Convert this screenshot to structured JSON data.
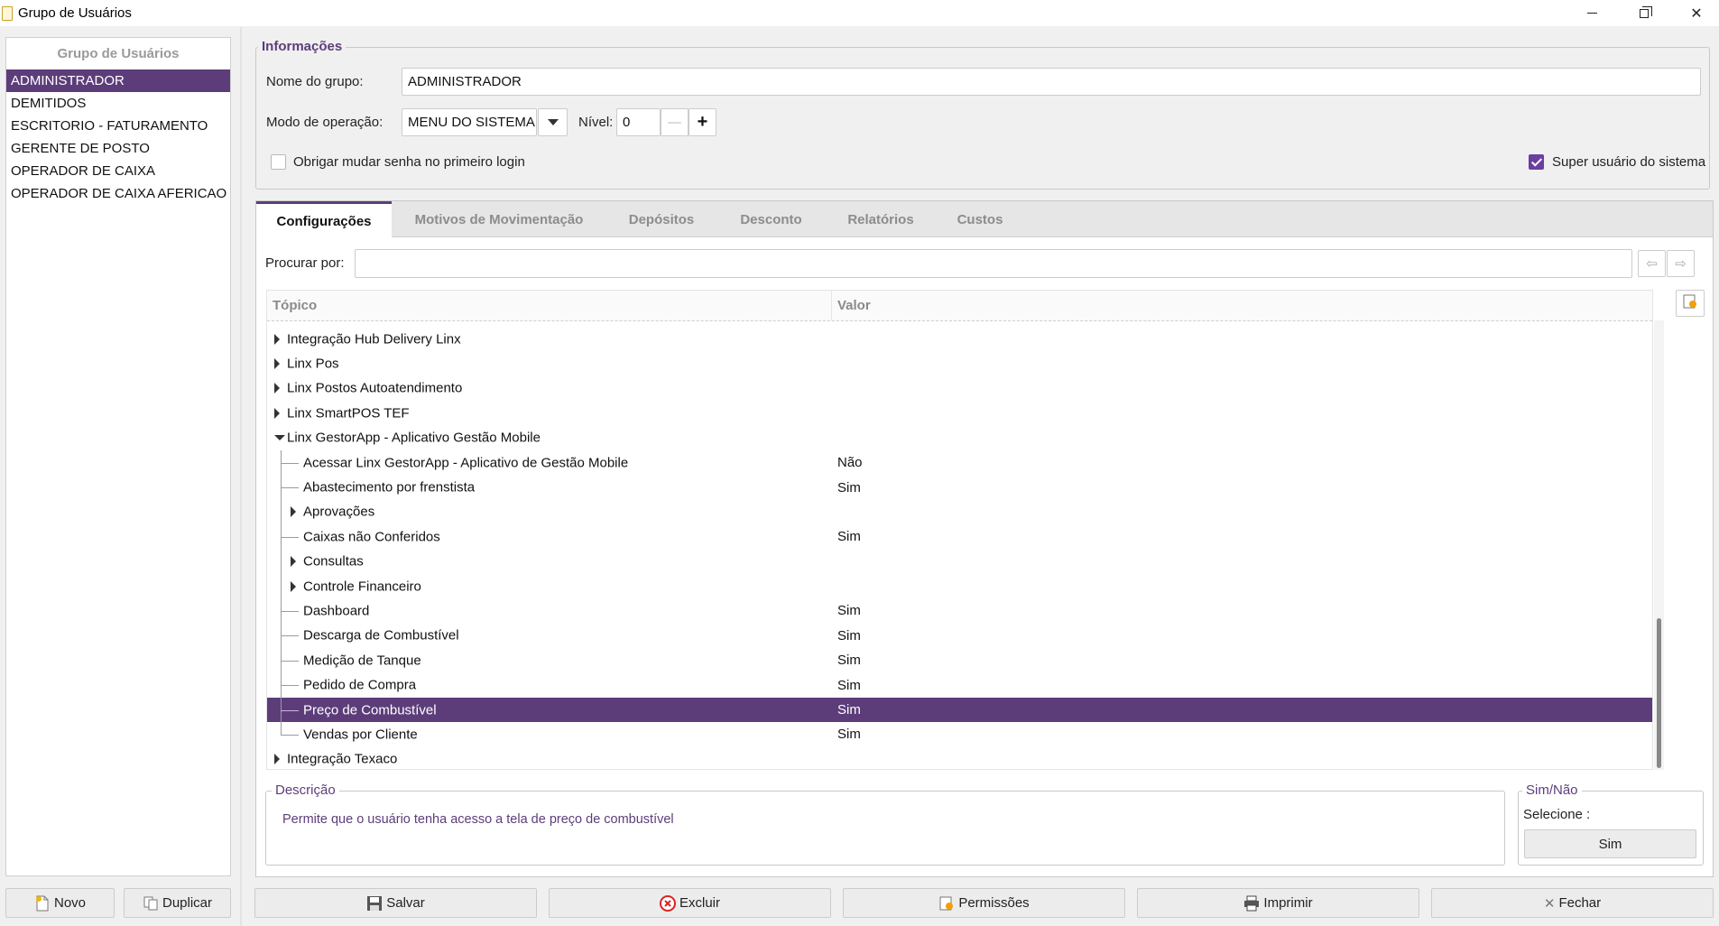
{
  "window": {
    "title": "Grupo de Usuários"
  },
  "left_panel": {
    "header": "Grupo de Usuários",
    "items": [
      {
        "label": "ADMINISTRADOR",
        "selected": true
      },
      {
        "label": "DEMITIDOS"
      },
      {
        "label": "ESCRITORIO - FATURAMENTO"
      },
      {
        "label": "GERENTE DE POSTO"
      },
      {
        "label": "OPERADOR DE CAIXA"
      },
      {
        "label": "OPERADOR DE CAIXA AFERICAO"
      }
    ],
    "buttons": {
      "novo": "Novo",
      "duplicar": "Duplicar"
    }
  },
  "info": {
    "legend": "Informações",
    "group_name_label": "Nome do grupo:",
    "group_name_value": "ADMINISTRADOR",
    "mode_label": "Modo de operação:",
    "mode_value": "MENU DO SISTEMA",
    "level_label": "Nível:",
    "level_value": "0",
    "force_password_label": "Obrigar mudar senha no primeiro login",
    "force_password_checked": false,
    "superuser_label": "Super usuário do sistema",
    "superuser_checked": true
  },
  "tabs": [
    {
      "label": "Configurações",
      "active": true
    },
    {
      "label": "Motivos de Movimentação"
    },
    {
      "label": "Depósitos"
    },
    {
      "label": "Desconto"
    },
    {
      "label": "Relatórios"
    },
    {
      "label": "Custos"
    }
  ],
  "search": {
    "label": "Procurar por:",
    "value": ""
  },
  "tree": {
    "columns": {
      "topic": "Tópico",
      "value": "Valor"
    },
    "rows": [
      {
        "label": "Integração Hub Delivery Linx",
        "level": 0,
        "expander": "collapsed",
        "value": ""
      },
      {
        "label": "Linx Pos",
        "level": 0,
        "expander": "collapsed",
        "value": ""
      },
      {
        "label": "Linx Postos Autoatendimento",
        "level": 0,
        "expander": "collapsed",
        "value": ""
      },
      {
        "label": "Linx SmartPOS TEF",
        "level": 0,
        "expander": "collapsed",
        "value": ""
      },
      {
        "label": "Linx GestorApp - Aplicativo Gestão Mobile",
        "level": 0,
        "expander": "expanded",
        "value": ""
      },
      {
        "label": "Acessar Linx GestorApp - Aplicativo de Gestão Mobile",
        "level": 1,
        "expander": "none",
        "value": "Não"
      },
      {
        "label": "Abastecimento por frenstista",
        "level": 1,
        "expander": "none",
        "value": "Sim"
      },
      {
        "label": "Aprovações",
        "level": 1,
        "expander": "collapsed",
        "value": ""
      },
      {
        "label": "Caixas não Conferidos",
        "level": 1,
        "expander": "none",
        "value": "Sim"
      },
      {
        "label": "Consultas",
        "level": 1,
        "expander": "collapsed",
        "value": ""
      },
      {
        "label": "Controle Financeiro",
        "level": 1,
        "expander": "collapsed",
        "value": ""
      },
      {
        "label": "Dashboard",
        "level": 1,
        "expander": "none",
        "value": "Sim"
      },
      {
        "label": "Descarga de Combustível",
        "level": 1,
        "expander": "none",
        "value": "Sim"
      },
      {
        "label": "Medição de Tanque",
        "level": 1,
        "expander": "none",
        "value": "Sim"
      },
      {
        "label": "Pedido de Compra",
        "level": 1,
        "expander": "none",
        "value": "Sim"
      },
      {
        "label": "Preço de Combustível",
        "level": 1,
        "expander": "none",
        "value": "Sim",
        "selected": true
      },
      {
        "label": "Vendas por Cliente",
        "level": 1,
        "expander": "none",
        "value": "Sim",
        "last": true
      },
      {
        "label": "Integração Texaco",
        "level": 0,
        "expander": "collapsed",
        "value": ""
      }
    ]
  },
  "description": {
    "legend": "Descrição",
    "text": "Permite que o usuário tenha acesso a tela de preço de combustível"
  },
  "simnao": {
    "legend": "Sim/Não",
    "select_label": "Selecione :",
    "button": "Sim"
  },
  "bottom_buttons": {
    "salvar": "Salvar",
    "excluir": "Excluir",
    "permissoes": "Permissões",
    "imprimir": "Imprimir",
    "fechar": "Fechar"
  },
  "colors": {
    "accent": "#5c3d7a",
    "checkbox": "#6a3fa0"
  }
}
